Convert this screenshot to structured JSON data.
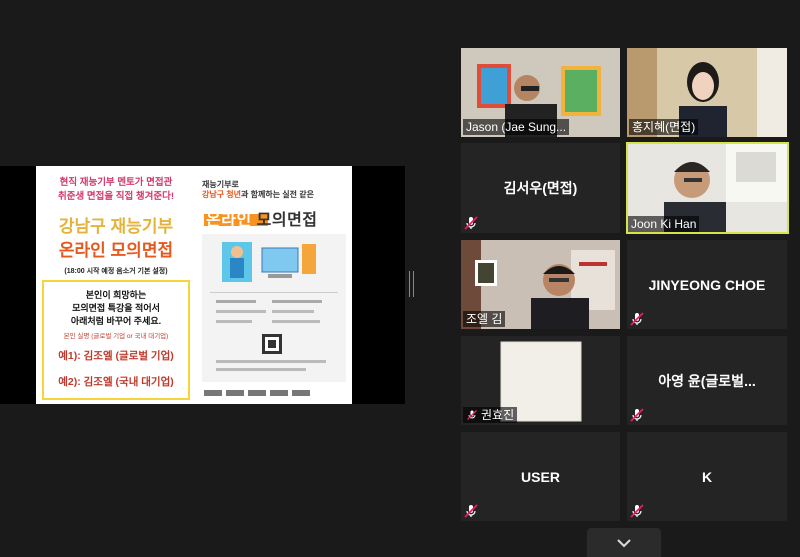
{
  "share": {
    "slide_left": {
      "header_line1": "현직 재능기부 멘토가 면접관",
      "header_line2": "취준생 면접을 직접 챙겨준다!",
      "title_line1": "강남구 재능기부",
      "title_line2": "온라인 모의면접",
      "note": "(18:00 시작 예정 음소거 기본 설정)",
      "box_line1": "본인이 희망하는",
      "box_line2": "모의면접 특강을 적어서",
      "box_line3": "아래처럼 바꾸어 주세요.",
      "box_small": "본인 실명 (글로벌 기업 or 국내 대기업)",
      "example1": "예1): 김조엘 (글로벌 기업)",
      "example2": "예2): 김조엘 (국내 대기업)"
    },
    "slide_right": {
      "line1": "재능기부로",
      "line2_a": "강남구 청년",
      "line2_b": "과 함께하는 실전 같은",
      "banner_a": "온라인",
      "banner_b": "모의면접"
    }
  },
  "participants": [
    {
      "name": "Jason (Jae Sung...",
      "video": true
    },
    {
      "name": "홍지혜(면접)",
      "video": true
    },
    {
      "name": "김서우(면접)",
      "video": false,
      "muted": true
    },
    {
      "name": "Joon Ki Han",
      "video": true,
      "active": true
    },
    {
      "name": "조엘 김",
      "video": true
    },
    {
      "name": "JINYEONG CHOE",
      "video": false,
      "muted": true
    },
    {
      "name": "권효진",
      "video": true,
      "muted": true
    },
    {
      "name": "아영 윤(글로벌...",
      "video": false,
      "muted": true
    },
    {
      "name": "USER",
      "video": false,
      "muted": true
    },
    {
      "name": "K",
      "video": false,
      "muted": true
    }
  ],
  "colors": {
    "accent_active": "#d6e44a",
    "muted_icon": "#e0245e",
    "background": "#1a1a1a"
  }
}
